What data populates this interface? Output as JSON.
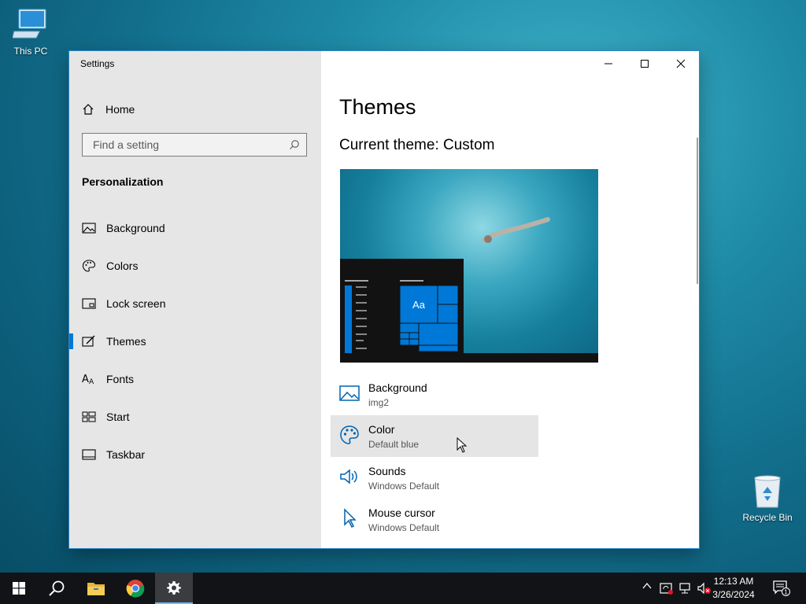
{
  "desktop": {
    "icons": [
      {
        "label": "This PC"
      },
      {
        "label": "Recycle Bin"
      }
    ]
  },
  "window": {
    "title": "Settings",
    "controls": {
      "minimize": "minimize-icon",
      "maximize": "maximize-icon",
      "close": "close-icon"
    }
  },
  "nav": {
    "home_label": "Home",
    "search": {
      "placeholder": "Find a setting",
      "value": ""
    },
    "section": "Personalization",
    "items": [
      {
        "label": "Background",
        "icon": "picture-icon"
      },
      {
        "label": "Colors",
        "icon": "palette-icon"
      },
      {
        "label": "Lock screen",
        "icon": "lock-screen-icon"
      },
      {
        "label": "Themes",
        "icon": "themes-icon",
        "selected": true
      },
      {
        "label": "Fonts",
        "icon": "fonts-icon"
      },
      {
        "label": "Start",
        "icon": "start-icon"
      },
      {
        "label": "Taskbar",
        "icon": "taskbar-icon"
      }
    ]
  },
  "content": {
    "title": "Themes",
    "current_theme": "Current theme: Custom",
    "preview": {
      "tile_label": "Aa",
      "accent": "#0078d7"
    },
    "settings": [
      {
        "title": "Background",
        "value": "img2",
        "icon": "picture-icon"
      },
      {
        "title": "Color",
        "value": "Default blue",
        "icon": "palette-icon"
      },
      {
        "title": "Sounds",
        "value": "Windows Default",
        "icon": "speaker-icon"
      },
      {
        "title": "Mouse cursor",
        "value": "Windows Default",
        "icon": "cursor-icon"
      }
    ]
  },
  "taskbar": {
    "apps": [
      "start-icon",
      "search-icon",
      "file-explorer-icon",
      "chrome-icon",
      "settings-gear-icon"
    ],
    "clock": {
      "time": "12:13 AM",
      "date": "3/26/2024"
    },
    "notification_count": "1"
  },
  "colors": {
    "accent": "#0078d7",
    "nav_bg": "#e6e6e6",
    "taskbar": "#111316"
  }
}
